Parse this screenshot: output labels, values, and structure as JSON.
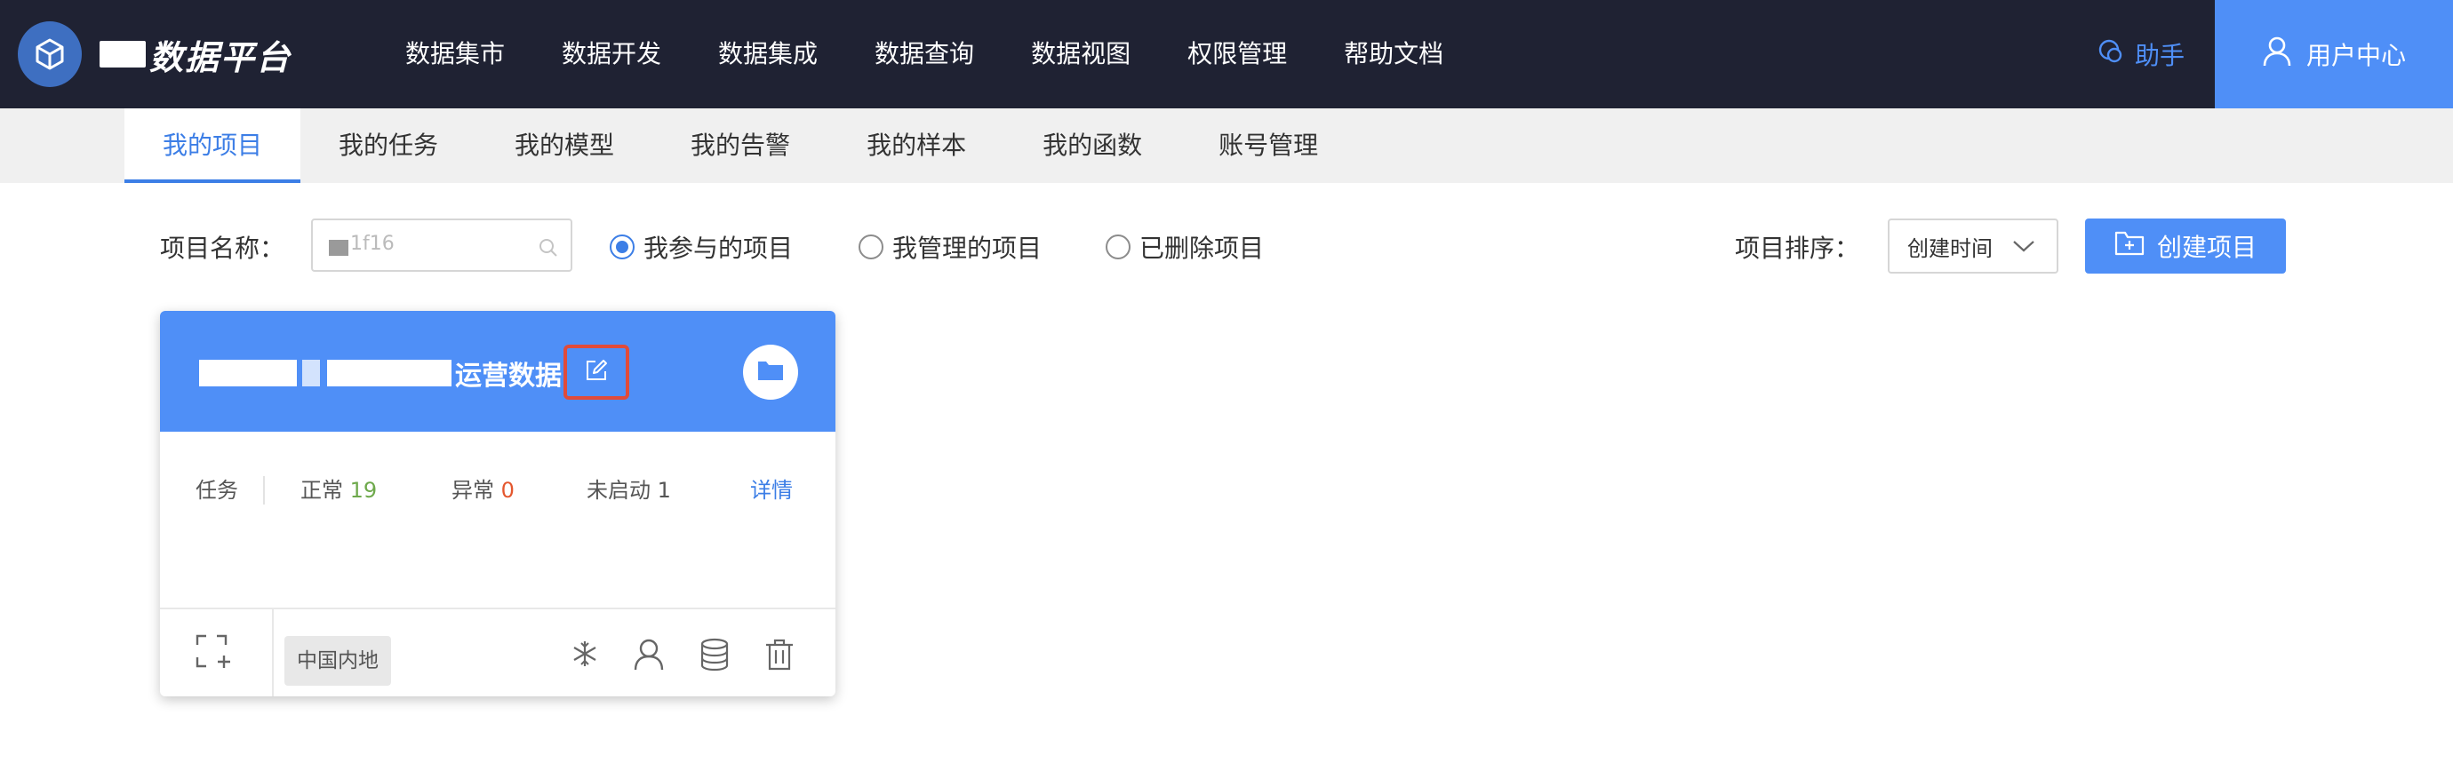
{
  "header": {
    "brand_suffix": "数据平台",
    "nav": [
      "数据集市",
      "数据开发",
      "数据集成",
      "数据查询",
      "数据视图",
      "权限管理",
      "帮助文档"
    ],
    "assistant_label": "助手",
    "user_center_label": "用户中心"
  },
  "subnav": {
    "tabs": [
      "我的项目",
      "我的任务",
      "我的模型",
      "我的告警",
      "我的样本",
      "我的函数",
      "账号管理"
    ],
    "active_index": 0
  },
  "filters": {
    "project_name_label": "项目名称：",
    "search_value": "1f16",
    "scope_options": [
      "我参与的项目",
      "我管理的项目",
      "已删除项目"
    ],
    "scope_selected_index": 0,
    "sort_label": "项目排序：",
    "sort_value": "创建时间",
    "create_button_label": "创建项目"
  },
  "project_card": {
    "title_visible": "运营数据",
    "task_label": "任务",
    "normal_label": "正常",
    "normal_count": "19",
    "error_label": "异常",
    "error_count": "0",
    "not_started_label": "未启动",
    "not_started_count": "1",
    "detail_link": "详情",
    "region_tag": "中国内地"
  },
  "colors": {
    "nav_bg": "#1f2233",
    "accent": "#4f8ff7",
    "active_tab": "#3c7ee6",
    "highlight_border": "#e04b3a",
    "normal_count": "#6ea94c",
    "error_count": "#e4572e"
  },
  "icons": {
    "logo": "cube-logo-icon",
    "assistant": "chat-bubble-icon",
    "user": "user-icon",
    "search": "search-icon",
    "sort": "chevron-down-icon",
    "create": "folder-plus-icon",
    "edit": "edit-icon",
    "folder": "folder-icon",
    "add_member": "scan-add-icon",
    "foot_actions": [
      "snowflake-icon",
      "user-icon",
      "database-icon",
      "trash-icon"
    ]
  }
}
